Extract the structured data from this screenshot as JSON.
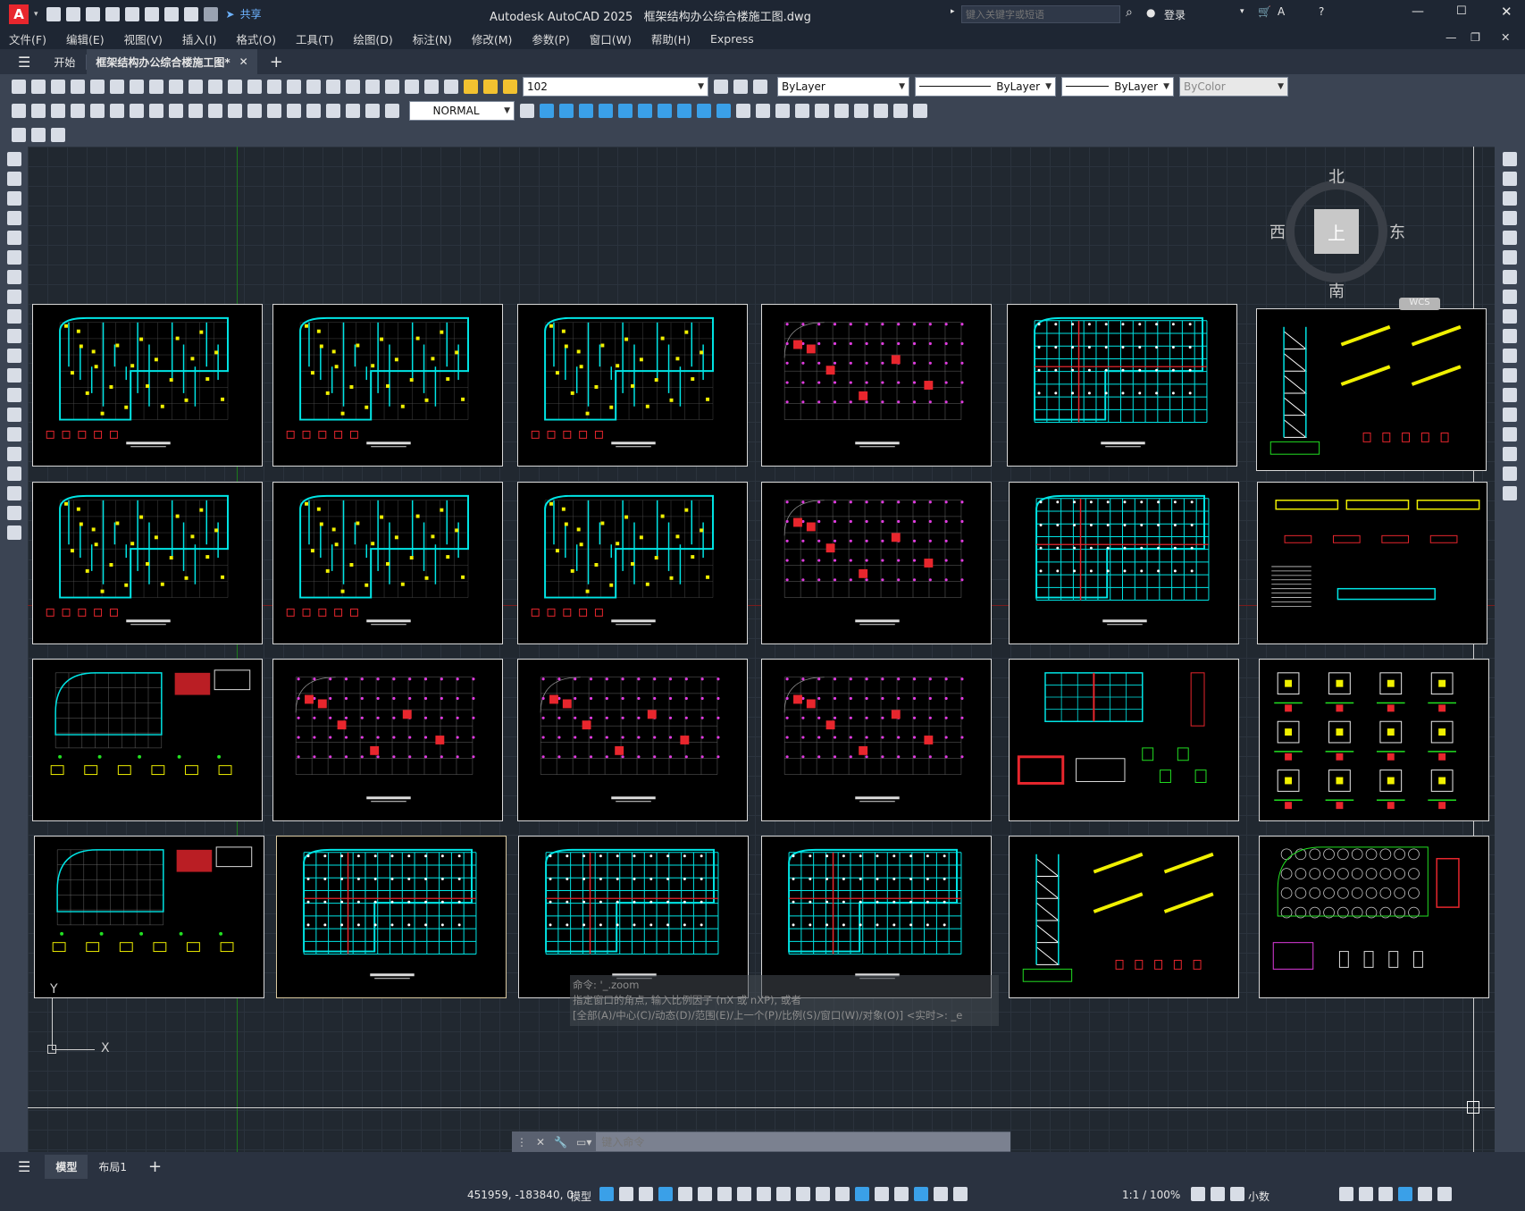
{
  "app": {
    "logo": "A",
    "title": "Autodesk AutoCAD 2025",
    "filename": "框架结构办公综合楼施工图.dwg",
    "search_placeholder": "键入关键字或短语",
    "login": "登录",
    "share": "共享"
  },
  "menu": [
    "文件(F)",
    "编辑(E)",
    "视图(V)",
    "插入(I)",
    "格式(O)",
    "工具(T)",
    "绘图(D)",
    "标注(N)",
    "修改(M)",
    "参数(P)",
    "窗口(W)",
    "帮助(H)",
    "Express"
  ],
  "tabs": {
    "start": "开始",
    "doc": "框架结构办公综合楼施工图*",
    "add": "+"
  },
  "toolbar": {
    "layer_name": "102",
    "color": "ByLayer",
    "linetype": "ByLayer",
    "lineweight": "ByLayer",
    "plotstyle": "ByColor",
    "dimstyle": "NORMAL"
  },
  "viewcube": {
    "north": "北",
    "south": "南",
    "east": "东",
    "west": "西",
    "top": "上",
    "wcs": "WCS"
  },
  "ucs": {
    "x": "X",
    "y": "Y"
  },
  "command": {
    "history": [
      "命令: '_.zoom",
      "指定窗口的角点, 输入比例因子 (nX 或 nXP), 或者",
      "[全部(A)/中心(C)/动态(D)/范围(E)/上一个(P)/比例(S)/窗口(W)/对象(O)] <实时>: _e"
    ],
    "placeholder": "键入命令"
  },
  "layout_tabs": {
    "model": "模型",
    "layout1": "布局1",
    "add": "+"
  },
  "status": {
    "coords": "451959, -183840, 0",
    "model": "模型",
    "scale": "1:1 / 100%",
    "units": "小数"
  },
  "colors": {
    "titlebar": "#1e2633",
    "canvas": "#212830",
    "accent": "#e8262d",
    "cyan": "#00e5e5",
    "yellow": "#f0f000",
    "magenta": "#e03ce0",
    "green": "#22e022"
  }
}
